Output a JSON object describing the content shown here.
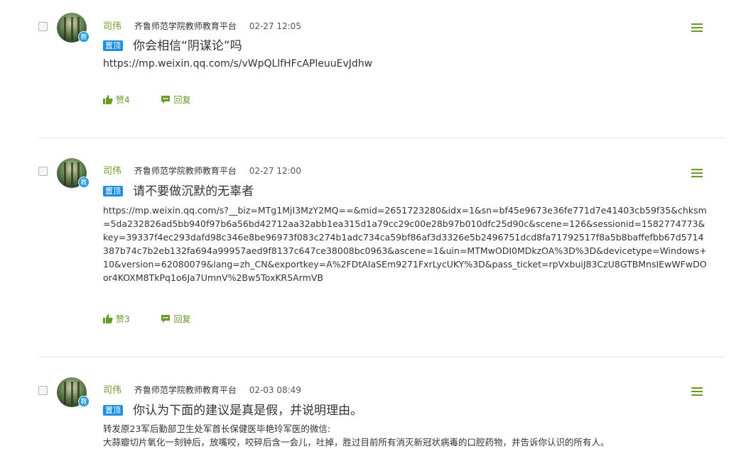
{
  "posts": [
    {
      "author": "司伟",
      "org": "齐鲁师范学院教师教育平台",
      "time": "02-27 12:05",
      "avatar_badge": "教",
      "pin_label": "置顶",
      "title": "你会相信“阴谋论”吗",
      "body": "https://mp.weixin.qq.com/s/vWpQLlfHFcAPleuuEvJdhw",
      "like_label": "赞4",
      "reply_label": "回复"
    },
    {
      "author": "司伟",
      "org": "齐鲁师范学院教师教育平台",
      "time": "02-27 12:00",
      "avatar_badge": "教",
      "pin_label": "置顶",
      "title": "请不要做沉默的无辜者",
      "body": "https://mp.weixin.qq.com/s?__biz=MTg1MjI3MzY2MQ==&mid=2651723280&idx=1&sn=bf45e9673e36fe771d7e41403cb59f35&chksm=5da232826ad5bb940f97b6a56bd42712aa32abb1ea315d1a79cc29c00e28b97b010dfc25d90c&scene=126&sessionid=1582774773&key=39337f4ec293dafd98c346e8be96973f083c274b1adc734ca59bf86af3d3326e5b2496751dcd8fa71792517f8a5b8baffefbb67d5714387b74c7b2eb132fa694a99957aed9f8137c647ce38008bc0963&ascene=1&uin=MTMwODI0MDkzOA%3D%3D&devicetype=Windows+10&version=62080079&lang=zh_CN&exportkey=A%2FDtAIaSEm9271FxrLycUKY%3D&pass_ticket=rpVxbuiJ83CzU8GTBMnsIEwWFwDOor4KOXM8TkPq1o6Ja7UmnV%2Bw5ToxKR5ArmVB",
      "like_label": "赞3",
      "reply_label": "回复"
    },
    {
      "author": "司伟",
      "org": "齐鲁师范学院教师教育平台",
      "time": "02-03 08:49",
      "avatar_badge": "教",
      "pin_label": "置顶",
      "title": "你认为下面的建议是真是假，并说明理由。",
      "body_line1": "转发原23军后勤部卫生处军首长保健医毕艳玲军医的微信:",
      "body_line2": "大蒜瓣切片氧化一刻钟后，放嘴咬，咬碎后含一会儿，吐掉，胜过目前所有消灭新冠状病毒的口腔药物，并告诉你认识的所有人。"
    }
  ],
  "colors": {
    "accent": "#6a9a2a",
    "pin": "#1a8fe0",
    "divider": "#e6e6e6"
  },
  "icons": {
    "like": "thumbs-up-icon",
    "reply": "chat-bubble-icon",
    "menu": "menu-icon"
  }
}
